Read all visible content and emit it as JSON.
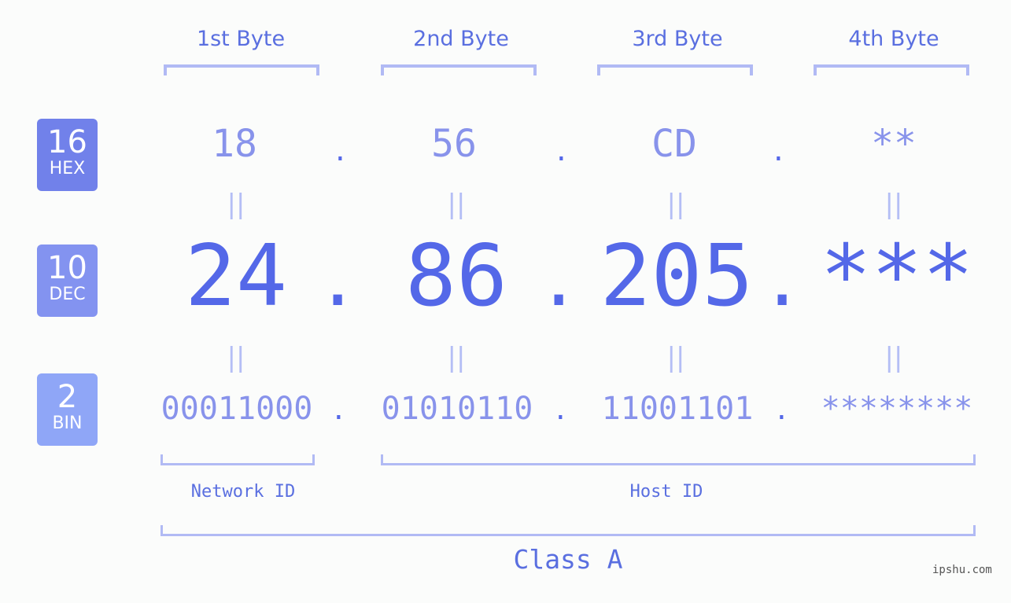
{
  "headers": [
    "1st Byte",
    "2nd Byte",
    "3rd Byte",
    "4th Byte"
  ],
  "badges": {
    "hex": {
      "num": "16",
      "label": "HEX",
      "color": "#7181ea"
    },
    "dec": {
      "num": "10",
      "label": "DEC",
      "color": "#8393f0"
    },
    "bin": {
      "num": "2",
      "label": "BIN",
      "color": "#8fa6f7"
    }
  },
  "hex": [
    "18",
    "56",
    "CD",
    "**"
  ],
  "dec": [
    "24",
    "86",
    "205",
    "***"
  ],
  "bin": [
    "00011000",
    "01010110",
    "11001101",
    "********"
  ],
  "separator": ".",
  "equals": "=",
  "network_label": "Network ID",
  "host_label": "Host ID",
  "class_label": "Class A",
  "watermark": "ipshu.com"
}
